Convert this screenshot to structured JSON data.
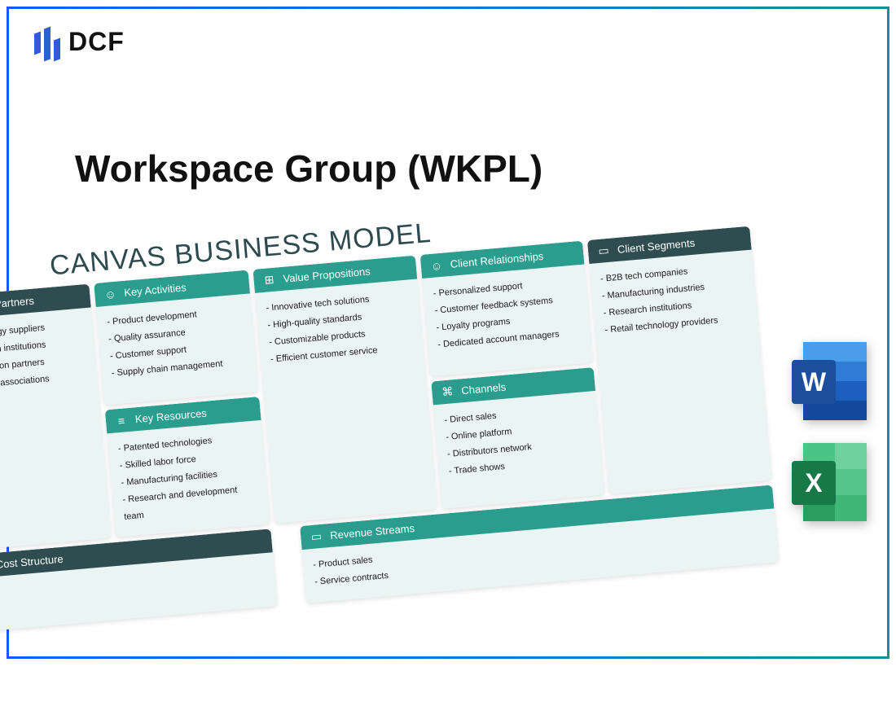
{
  "logo": {
    "text": "DCF"
  },
  "title": "Workspace Group (WKPL)",
  "canvas": {
    "title": "CANVAS BUSINESS MODEL",
    "keyPartners": {
      "label": "Key Partners",
      "items": [
        "Technology suppliers",
        "Research institutions",
        "Distribution partners",
        "Industry associations"
      ]
    },
    "keyActivities": {
      "label": "Key Activities",
      "items": [
        "Product development",
        "Quality assurance",
        "Customer support",
        "Supply chain management"
      ]
    },
    "keyResources": {
      "label": "Key Resources",
      "items": [
        "Patented technologies",
        "Skilled labor force",
        "Manufacturing facilities",
        "Research and development team"
      ]
    },
    "valuePropositions": {
      "label": "Value Propositions",
      "items": [
        "Innovative tech solutions",
        "High-quality standards",
        "Customizable products",
        "Efficient customer service"
      ]
    },
    "clientRelationships": {
      "label": "Client Relationships",
      "items": [
        "Personalized support",
        "Customer feedback systems",
        "Loyalty programs",
        "Dedicated account managers"
      ]
    },
    "channels": {
      "label": "Channels",
      "items": [
        "Direct sales",
        "Online platform",
        "Distributors network",
        "Trade shows"
      ]
    },
    "clientSegments": {
      "label": "Client Segments",
      "items": [
        "B2B tech companies",
        "Manufacturing industries",
        "Research institutions",
        "Retail technology providers"
      ]
    },
    "costStructure": {
      "label": "Cost Structure",
      "items": []
    },
    "revenueStreams": {
      "label": "Revenue Streams",
      "items": [
        "Product sales",
        "Service contracts"
      ]
    }
  },
  "apps": {
    "word": "W",
    "excel": "X"
  }
}
